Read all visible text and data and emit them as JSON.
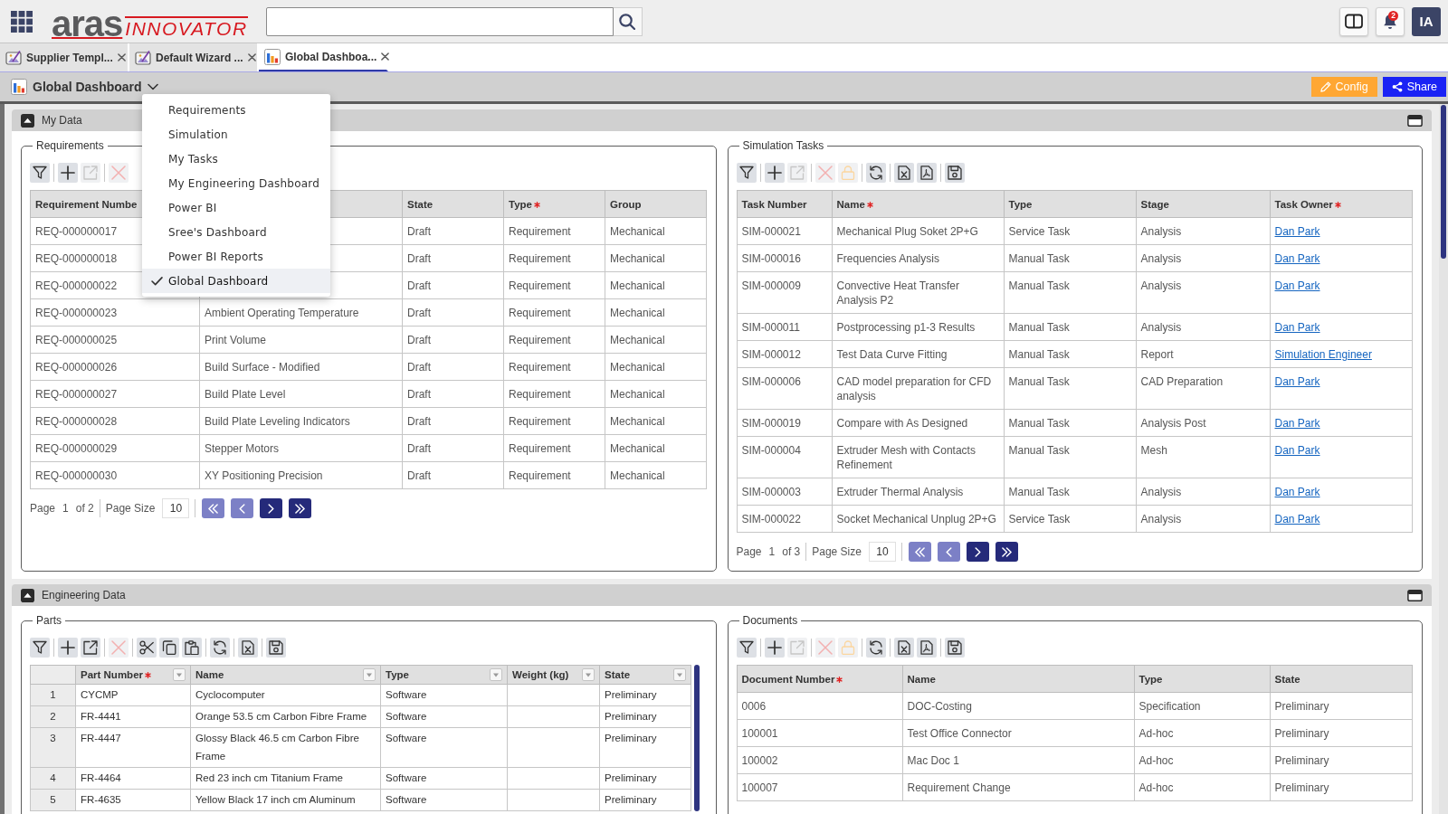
{
  "app_bar": {
    "logo": {
      "brand": "aras",
      "product": "INNOVATOR"
    },
    "notifications": {
      "count": "2"
    },
    "user": {
      "initials": "IA"
    }
  },
  "tabs": [
    {
      "kind": "wizard",
      "label": "Supplier Templ...",
      "selected": false
    },
    {
      "kind": "wizard",
      "label": "Default Wizard ...",
      "selected": false
    },
    {
      "kind": "dashboard",
      "label": "Global Dashboa...",
      "selected": true
    }
  ],
  "dashboard_bar": {
    "title": "Global Dashboard",
    "menu_open": true,
    "actions": [
      {
        "kind": "config",
        "label": "Config"
      },
      {
        "kind": "share",
        "label": "Share"
      }
    ]
  },
  "dashboard_menu": [
    {
      "label": "Requirements",
      "selected": false
    },
    {
      "label": "Simulation",
      "selected": false
    },
    {
      "label": "My Tasks",
      "selected": false
    },
    {
      "label": "My Engineering Dashboard",
      "selected": false
    },
    {
      "label": "Power BI",
      "selected": false
    },
    {
      "label": "Sree's Dashboard",
      "selected": false
    },
    {
      "label": "Power BI Reports",
      "selected": false
    },
    {
      "label": "Global Dashboard",
      "selected": true
    }
  ],
  "sections": [
    {
      "title": "My Data",
      "expanded": true,
      "panels": [
        {
          "title": "Requirements",
          "toolbar": [
            [
              {
                "kind": "filter",
                "disabled": false
              }
            ],
            [
              {
                "kind": "add",
                "disabled": false
              },
              {
                "kind": "edit",
                "disabled": true
              }
            ],
            [
              {
                "kind": "delete",
                "disabled": true
              }
            ]
          ],
          "table": {
            "kind": "list",
            "columns": [
              {
                "label": "Requirement Numbe",
                "required": false
              },
              null,
              {
                "label": "State",
                "required": false
              },
              {
                "label": "Type",
                "required": true
              },
              {
                "label": "Group",
                "required": false
              }
            ],
            "rows": [
              [
                "REQ-000000017",
                null,
                "Draft",
                "Requirement",
                "Mechanical"
              ],
              [
                "REQ-000000018",
                null,
                "Draft",
                "Requirement",
                "Mechanical"
              ],
              [
                "REQ-000000022",
                null,
                "Draft",
                "Requirement",
                "Mechanical"
              ],
              [
                "REQ-000000023",
                "Ambient Operating Temperature",
                "Draft",
                "Requirement",
                "Mechanical"
              ],
              [
                "REQ-000000025",
                "Print Volume",
                "Draft",
                "Requirement",
                "Mechanical"
              ],
              [
                "REQ-000000026",
                "Build Surface - Modified",
                "Draft",
                "Requirement",
                "Mechanical"
              ],
              [
                "REQ-000000027",
                "Build Plate Level",
                "Draft",
                "Requirement",
                "Mechanical"
              ],
              [
                "REQ-000000028",
                "Build Plate Leveling Indicators",
                "Draft",
                "Requirement",
                "Mechanical"
              ],
              [
                "REQ-000000029",
                "Stepper Motors",
                "Draft",
                "Requirement",
                "Mechanical"
              ],
              [
                "REQ-000000030",
                "XY Positioning Precision",
                "Draft",
                "Requirement",
                "Mechanical"
              ]
            ]
          },
          "pagination": {
            "page_label": "Page",
            "page": "1",
            "total": "of 2",
            "size_label": "Page Size",
            "size": "10",
            "buttons": [
              {
                "kind": "first",
                "disabled": true
              },
              {
                "kind": "previous",
                "disabled": true
              },
              {
                "kind": "next",
                "disabled": false
              },
              {
                "kind": "last",
                "disabled": false
              }
            ]
          }
        },
        {
          "title": "Simulation Tasks",
          "toolbar": [
            [
              {
                "kind": "filter",
                "disabled": false
              }
            ],
            [
              {
                "kind": "add",
                "disabled": false
              },
              {
                "kind": "edit",
                "disabled": true
              }
            ],
            [
              {
                "kind": "delete",
                "disabled": true
              },
              {
                "kind": "lock",
                "disabled": true
              }
            ],
            [
              {
                "kind": "refresh",
                "disabled": false
              }
            ],
            [
              {
                "kind": "excel",
                "disabled": false
              },
              {
                "kind": "pdf",
                "disabled": false
              }
            ],
            [
              {
                "kind": "save",
                "disabled": false
              }
            ]
          ],
          "table": {
            "kind": "list",
            "columns": [
              {
                "label": "Task Number",
                "required": false,
                "kind": "text"
              },
              {
                "label": "Name",
                "required": true,
                "kind": "text"
              },
              {
                "label": "Type",
                "required": false,
                "kind": "text"
              },
              {
                "label": "Stage",
                "required": false,
                "kind": "text"
              },
              {
                "label": "Task Owner",
                "required": true,
                "kind": "link"
              }
            ],
            "rows": [
              [
                "SIM-000021",
                "Mechanical Plug Soket 2P+G",
                "Service Task",
                "Analysis",
                "Dan Park"
              ],
              [
                "SIM-000016",
                "Frequencies Analysis",
                "Manual Task",
                "Analysis",
                "Dan Park"
              ],
              [
                "SIM-000009",
                "Convective Heat Transfer Analysis P2",
                "Manual Task",
                "Analysis",
                "Dan Park"
              ],
              [
                "SIM-000011",
                "Postprocessing p1-3 Results",
                "Manual Task",
                "Analysis",
                "Dan Park"
              ],
              [
                "SIM-000012",
                "Test Data Curve Fitting",
                "Manual Task",
                "Report",
                "Simulation Engineer"
              ],
              [
                "SIM-000006",
                "CAD model preparation for CFD analysis",
                "Manual Task",
                "CAD Preparation",
                "Dan Park"
              ],
              [
                "SIM-000019",
                "Compare with As Designed",
                "Manual Task",
                "Analysis Post",
                "Dan Park"
              ],
              [
                "SIM-000004",
                "Extruder Mesh with Contacts Refinement",
                "Manual Task",
                "Mesh",
                "Dan Park"
              ],
              [
                "SIM-000003",
                "Extruder Thermal Analysis",
                "Manual Task",
                "Analysis",
                "Dan Park"
              ],
              [
                "SIM-000022",
                "Socket Mechanical Unplug 2P+G",
                "Service Task",
                "Analysis",
                "Dan Park"
              ]
            ]
          },
          "pagination": {
            "page_label": "Page",
            "page": "1",
            "total": "of 3",
            "size_label": "Page Size",
            "size": "10",
            "buttons": [
              {
                "kind": "first",
                "disabled": true
              },
              {
                "kind": "previous",
                "disabled": true
              },
              {
                "kind": "next",
                "disabled": false
              },
              {
                "kind": "last",
                "disabled": false
              }
            ]
          }
        }
      ]
    },
    {
      "title": "Engineering Data",
      "expanded": true,
      "panels": [
        {
          "title": "Parts",
          "toolbar": [
            [
              {
                "kind": "filter",
                "disabled": false
              }
            ],
            [
              {
                "kind": "add",
                "disabled": false
              },
              {
                "kind": "edit",
                "disabled": false
              }
            ],
            [
              {
                "kind": "delete",
                "disabled": true
              }
            ],
            [
              {
                "kind": "cut",
                "disabled": false
              },
              {
                "kind": "copy",
                "disabled": false
              },
              {
                "kind": "paste",
                "disabled": false
              }
            ],
            [
              {
                "kind": "refresh",
                "disabled": false
              }
            ],
            [
              {
                "kind": "excel",
                "disabled": false
              }
            ],
            [
              {
                "kind": "save",
                "disabled": false
              }
            ]
          ],
          "table": {
            "kind": "grid",
            "columns": [
              {
                "label": "Part Number",
                "required": true
              },
              {
                "label": "Name",
                "required": false
              },
              {
                "label": "Type",
                "required": false
              },
              {
                "label": "Weight (kg)",
                "required": false
              },
              {
                "label": "State",
                "required": false
              }
            ],
            "rows": [
              {
                "number": "1",
                "cells": [
                  "CYCMP",
                  "Cyclocomputer",
                  "Software",
                  null,
                  "Preliminary"
                ]
              },
              {
                "number": "2",
                "cells": [
                  "FR-4441",
                  "Orange 53.5 cm Carbon Fibre Frame",
                  "Software",
                  null,
                  "Preliminary"
                ]
              },
              {
                "number": "3",
                "cells": [
                  "FR-4447",
                  "Glossy Black 46.5 cm Carbon Fibre Frame",
                  "Software",
                  null,
                  "Preliminary"
                ]
              },
              {
                "number": "4",
                "cells": [
                  "FR-4464",
                  "Red 23 inch cm Titanium Frame",
                  "Software",
                  null,
                  "Preliminary"
                ]
              },
              {
                "number": "5",
                "cells": [
                  "FR-4635",
                  "Yellow Black 17 inch cm Aluminum",
                  "Software",
                  null,
                  "Preliminary"
                ]
              }
            ]
          }
        },
        {
          "title": "Documents",
          "toolbar": [
            [
              {
                "kind": "filter",
                "disabled": false
              }
            ],
            [
              {
                "kind": "add",
                "disabled": false
              },
              {
                "kind": "edit",
                "disabled": true
              }
            ],
            [
              {
                "kind": "delete",
                "disabled": true
              },
              {
                "kind": "lock",
                "disabled": true
              }
            ],
            [
              {
                "kind": "refresh",
                "disabled": false
              }
            ],
            [
              {
                "kind": "excel",
                "disabled": false
              },
              {
                "kind": "pdf",
                "disabled": false
              }
            ],
            [
              {
                "kind": "save",
                "disabled": false
              }
            ]
          ],
          "table": {
            "kind": "list",
            "columns": [
              {
                "label": "Document Number",
                "required": true
              },
              {
                "label": "Name",
                "required": false
              },
              {
                "label": "Type",
                "required": false
              },
              {
                "label": "State",
                "required": false
              }
            ],
            "rows": [
              [
                "0006",
                "DOC-Costing",
                "Specification",
                "Preliminary"
              ],
              [
                "100001",
                "Test Office Connector",
                "Ad-hoc",
                "Preliminary"
              ],
              [
                "100002",
                "Mac Doc 1",
                "Ad-hoc",
                "Preliminary"
              ],
              [
                "100007",
                "Requirement Change",
                "Ad-hoc",
                "Preliminary"
              ]
            ]
          }
        }
      ]
    }
  ]
}
